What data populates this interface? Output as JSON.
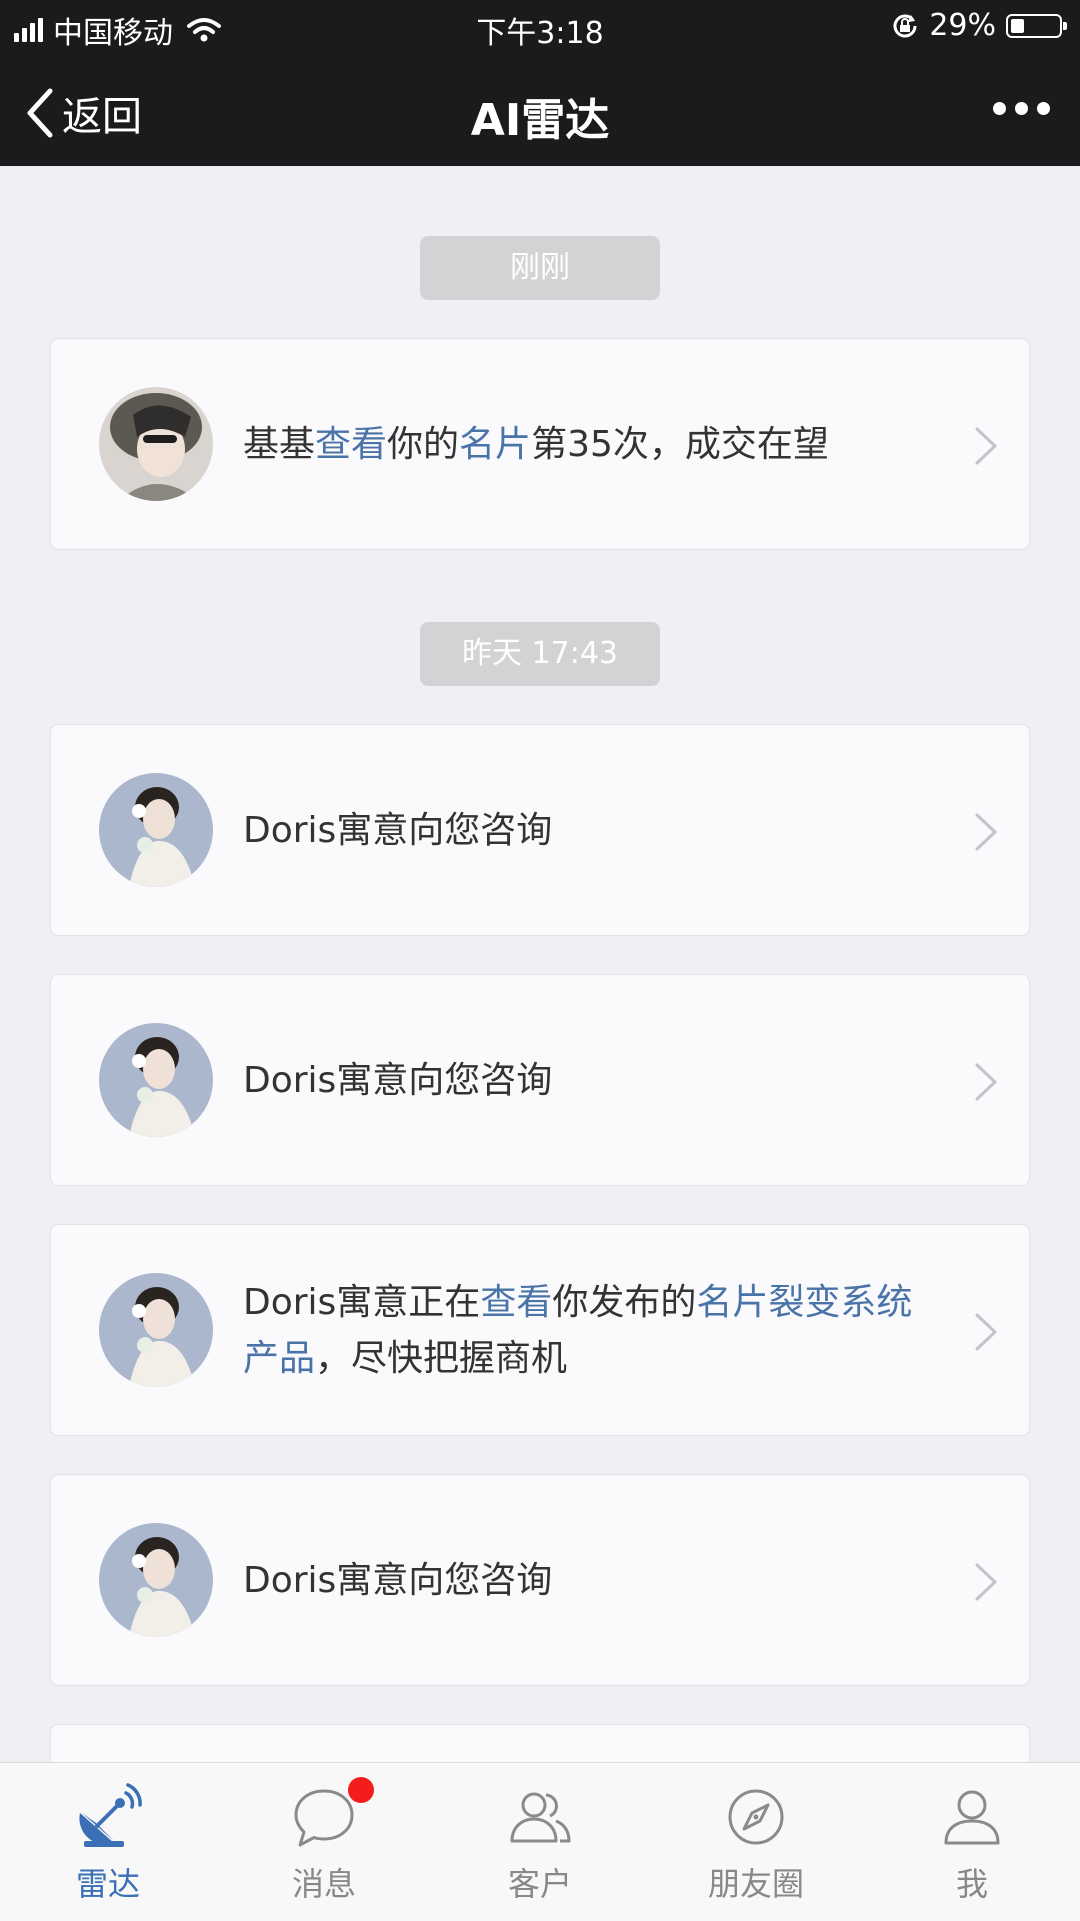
{
  "status_bar": {
    "carrier": "中国移动",
    "time": "下午3:18",
    "battery": "29%",
    "battery_level": 0.29
  },
  "nav": {
    "back_label": "返回",
    "title": "AI雷达"
  },
  "feed": [
    {
      "timestamp": "刚刚",
      "cards": [
        {
          "avatar": "user-avatar-jiji",
          "parts": [
            {
              "text": "基基",
              "highlight": false
            },
            {
              "text": "查看",
              "highlight": true
            },
            {
              "text": "你的",
              "highlight": false
            },
            {
              "text": "名片",
              "highlight": true
            },
            {
              "text": "第35次，成交在望",
              "highlight": false
            }
          ]
        }
      ]
    },
    {
      "timestamp": "昨天 17:43",
      "cards": [
        {
          "avatar": "user-avatar-doris",
          "parts": [
            {
              "text": "Doris寓意向您咨询",
              "highlight": false
            }
          ]
        },
        {
          "avatar": "user-avatar-doris",
          "parts": [
            {
              "text": "Doris寓意向您咨询",
              "highlight": false
            }
          ]
        },
        {
          "avatar": "user-avatar-doris",
          "parts": [
            {
              "text": "Doris寓意正在",
              "highlight": false
            },
            {
              "text": "查看",
              "highlight": true
            },
            {
              "text": "你发布的",
              "highlight": false
            },
            {
              "text": "名片裂变系统产品",
              "highlight": true
            },
            {
              "text": "，尽快把握商机",
              "highlight": false
            }
          ]
        },
        {
          "avatar": "user-avatar-doris",
          "parts": [
            {
              "text": "Doris寓意向您咨询",
              "highlight": false
            }
          ]
        }
      ]
    }
  ],
  "tabs": [
    {
      "label": "雷达",
      "icon": "radar-icon",
      "active": true,
      "badge": false
    },
    {
      "label": "消息",
      "icon": "message-icon",
      "active": false,
      "badge": true
    },
    {
      "label": "客户",
      "icon": "customers-icon",
      "active": false,
      "badge": false
    },
    {
      "label": "朋友圈",
      "icon": "compass-icon",
      "active": false,
      "badge": false
    },
    {
      "label": "我",
      "icon": "profile-icon",
      "active": false,
      "badge": false
    }
  ],
  "colors": {
    "highlight": "#4a73a8",
    "active_tab": "#3b6fb6",
    "badge": "#f51c1c",
    "header_bg": "#1b1b1d"
  }
}
